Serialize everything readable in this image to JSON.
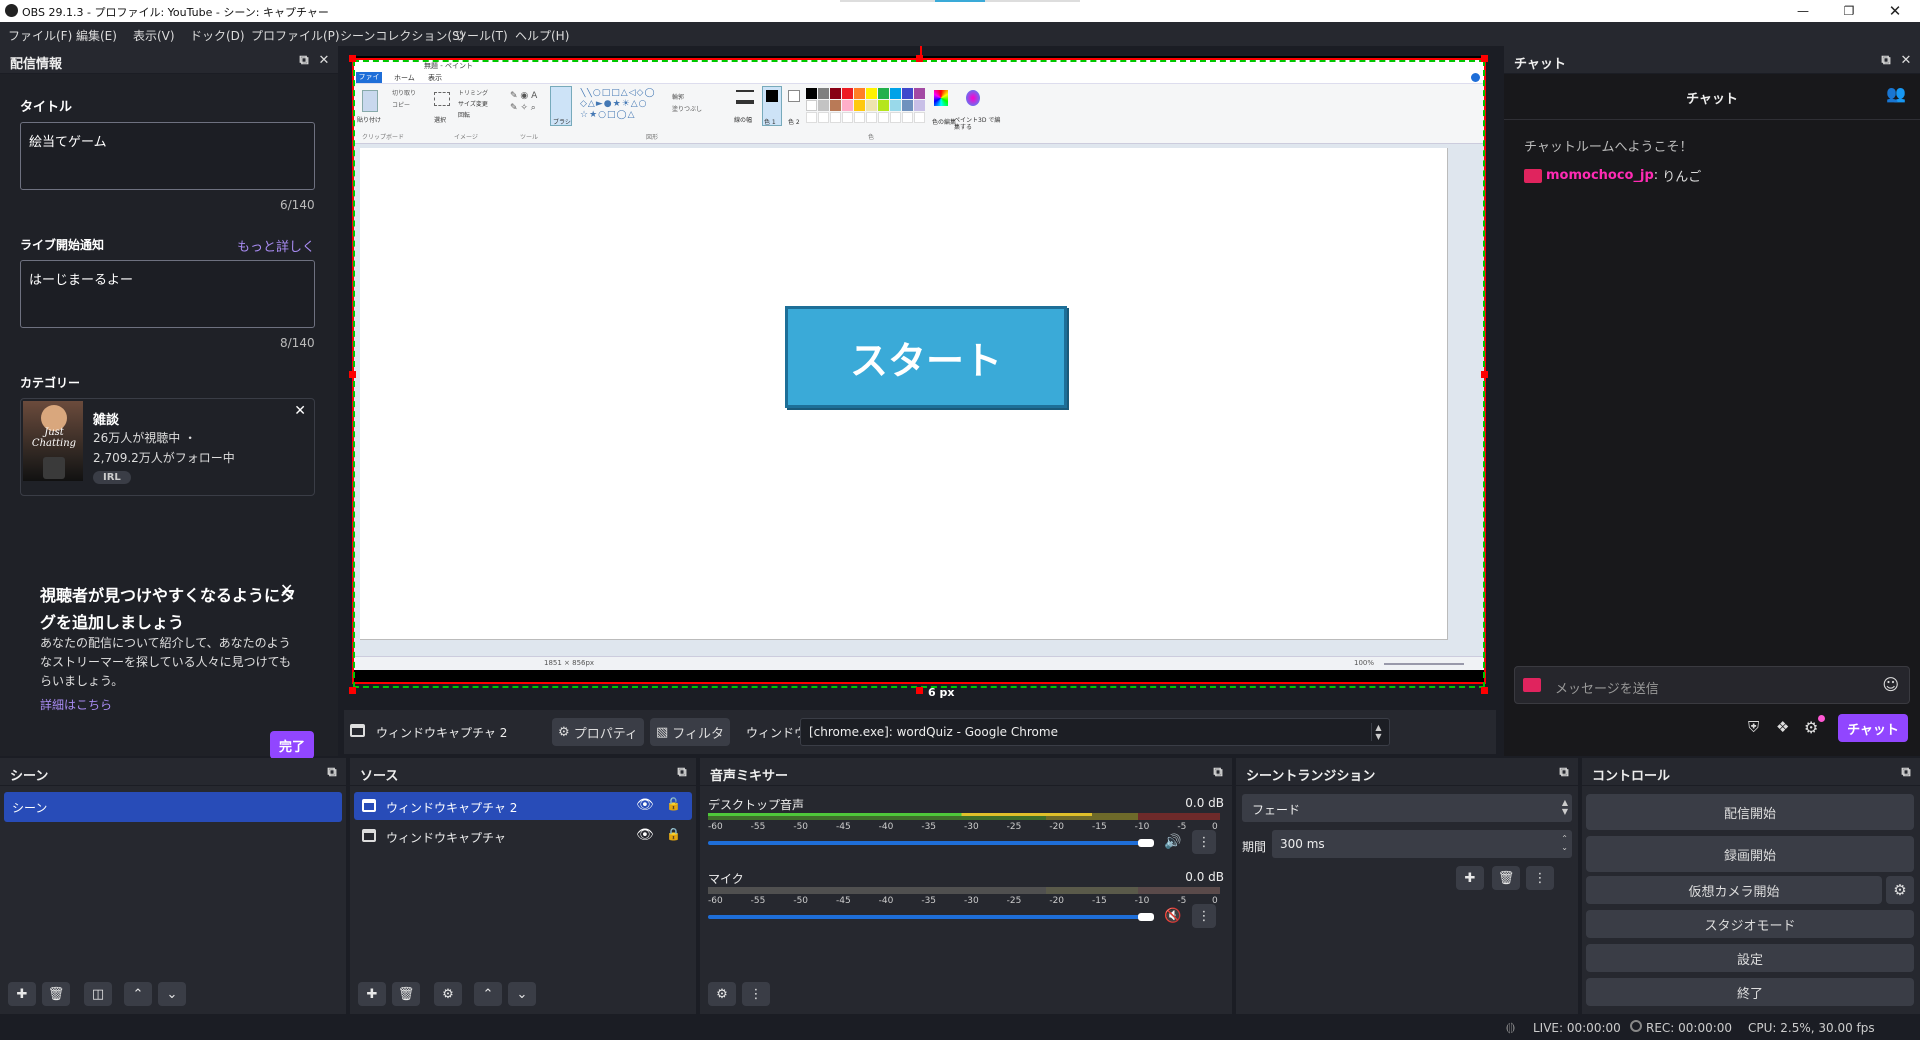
{
  "window": {
    "title": "OBS 29.1.3 - プロファイル: YouTube - シーン: キャプチャー"
  },
  "menu": [
    "ファイル(F)",
    "編集(E)",
    "表示(V)",
    "ドック(D)",
    "プロファイル(P)",
    "シーンコレクション(S)",
    "ツール(T)",
    "ヘルプ(H)"
  ],
  "stream_info": {
    "header": "配信情報",
    "title_label": "タイトル",
    "title_value": "絵当てゲーム",
    "title_count": "6/140",
    "notify_label": "ライブ開始通知",
    "notify_more": "もっと詳しく",
    "notify_value": "はーじまーるよー",
    "notify_count": "8/140",
    "category_label": "カテゴリー",
    "category_name": "雑談",
    "category_viewers": "26万人が視聴中 ・",
    "category_followers": "2,709.2万人がフォロー中",
    "category_tag": "IRL",
    "category_art_text": "Just Chatting",
    "promo_title": "視聴者が見つけやすくなるようにタグを追加しましょう",
    "promo_body": "あなたの配信について紹介して、あなたのようなストリーマーを探している人々に見つけてもらいましょう。",
    "promo_link": "詳細はこちら",
    "done_button": "完了"
  },
  "preview": {
    "paint_title": "無題 - ペイント",
    "paint_tabs": [
      "ファイル",
      "ホーム",
      "表示"
    ],
    "paint_groups": [
      "クリップボード",
      "イメージ",
      "ツール",
      "図形",
      "色"
    ],
    "paint_buttons": [
      "貼り付け",
      "切り取り",
      "コピー",
      "選択",
      "トリミング",
      "サイズ変更",
      "回転",
      "ブラシ",
      "輪郭",
      "塗りつぶし",
      "線の幅",
      "色 1",
      "色 2",
      "色の編集",
      "ペイント3D で編集する"
    ],
    "paint_status": [
      "1851 × 856px",
      "100%"
    ],
    "canvas_button": "スタート",
    "edge_label": "6 px"
  },
  "source_toolbar": {
    "source_name": "ウィンドウキャプチャ 2",
    "properties": "プロパティ",
    "filters": "フィルタ",
    "window_label": "ウィンドウ",
    "window_value": "[chrome.exe]: wordQuiz - Google Chrome"
  },
  "chat": {
    "header": "チャット",
    "title": "チャット",
    "welcome": "チャットルームへようこそ！",
    "user": "momochoco_jp",
    "message": "りんご",
    "input_placeholder": "メッセージを送信",
    "send_button": "チャット"
  },
  "scenes": {
    "header": "シーン",
    "items": [
      "シーン"
    ]
  },
  "sources": {
    "header": "ソース",
    "items": [
      "ウィンドウキャプチャ 2",
      "ウィンドウキャプチャ"
    ]
  },
  "mixer": {
    "header": "音声ミキサー",
    "channels": [
      {
        "name": "デスクトップ音声",
        "db": "0.0 dB",
        "level": 0.75,
        "volume": 1.0,
        "muted": false
      },
      {
        "name": "マイク",
        "db": "0.0 dB",
        "level": 0.0,
        "volume": 1.0,
        "muted": true
      }
    ],
    "ticks": [
      "-60",
      "-55",
      "-50",
      "-45",
      "-40",
      "-35",
      "-30",
      "-25",
      "-20",
      "-15",
      "-10",
      "-5",
      "0"
    ]
  },
  "transitions": {
    "header": "シーントランジション",
    "type": "フェード",
    "duration_label": "期間",
    "duration_value": "300 ms"
  },
  "controls": {
    "header": "コントロール",
    "buttons": [
      "配信開始",
      "録画開始",
      "仮想カメラ開始",
      "スタジオモード",
      "設定",
      "終了"
    ]
  },
  "status": {
    "live": "LIVE: 00:00:00",
    "rec": "REC: 00:00:00",
    "cpu": "CPU: 2.5%, 30.00 fps"
  },
  "colors": {
    "accent": "#9146ff",
    "selection": "#284cb8",
    "start_button": "#3aaad8",
    "preview_border": "#ff0000",
    "safe_guide": "#00c800"
  }
}
